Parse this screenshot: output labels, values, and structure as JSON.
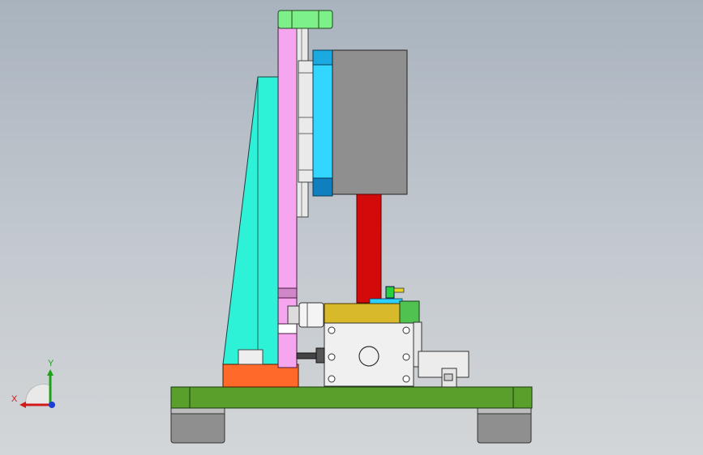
{
  "viewport": {
    "background_top": "#a9b3be",
    "background_bottom": "#d3d6d8"
  },
  "parts": {
    "base_plate_color": "#5a9e2c",
    "rubber_foot_color": "#8f8f8f",
    "gusset_color": "#2ef2d8",
    "column_plate_color": "#f6a6ee",
    "top_cap_color": "#7ef08a",
    "motor_body_color": "#8f8f8f",
    "motor_flange_color": "#33d6ff",
    "red_rod_color": "#d40a0a",
    "gear_block_color": "#f0f0f0",
    "yellow_plate_color": "#d8b92a",
    "orange_block_color": "#ff6a2a"
  },
  "triad": {
    "x_label": "X",
    "y_label": "Y",
    "x_color": "#d21a1a",
    "y_color": "#1aa31a",
    "z_color": "#1a3fd2"
  }
}
